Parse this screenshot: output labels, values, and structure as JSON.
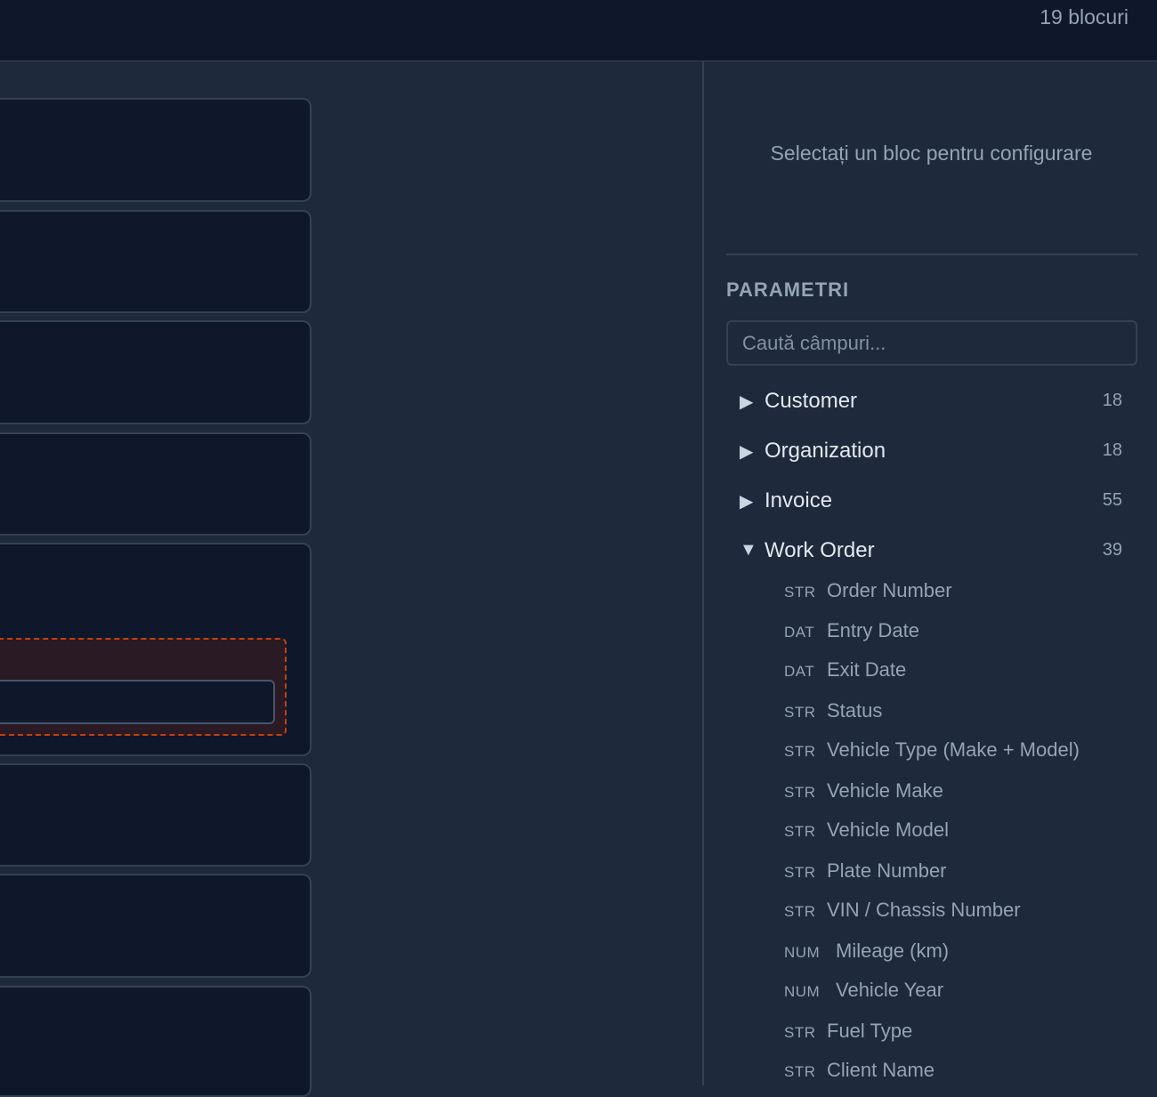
{
  "header": {
    "block_count": "19 blocuri"
  },
  "sidebar": {
    "empty_message": "Selectați un bloc pentru configurare",
    "section_title": "PARAMETRI",
    "search_placeholder": "Caută câmpuri...",
    "groups": [
      {
        "arrow": "▶",
        "name": "Customer",
        "count": "18"
      },
      {
        "arrow": "▶",
        "name": "Organization",
        "count": "18"
      },
      {
        "arrow": "▶",
        "name": "Invoice",
        "count": "55"
      },
      {
        "arrow": "▼",
        "name": "Work Order",
        "count": "39"
      }
    ],
    "fields": [
      {
        "type": "STR",
        "label": "Order Number"
      },
      {
        "type": "DAT",
        "label": "Entry Date"
      },
      {
        "type": "DAT",
        "label": "Exit Date"
      },
      {
        "type": "STR",
        "label": "Status"
      },
      {
        "type": "STR",
        "label": "Vehicle Type (Make + Model)"
      },
      {
        "type": "STR",
        "label": "Vehicle Make"
      },
      {
        "type": "STR",
        "label": "Vehicle Model"
      },
      {
        "type": "STR",
        "label": "Plate Number"
      },
      {
        "type": "STR",
        "label": "VIN / Chassis Number"
      },
      {
        "type": "NUM",
        "label": "Mileage (km)"
      },
      {
        "type": "NUM",
        "label": "Vehicle Year"
      },
      {
        "type": "STR",
        "label": "Fuel Type"
      },
      {
        "type": "STR",
        "label": "Client Name"
      }
    ]
  }
}
